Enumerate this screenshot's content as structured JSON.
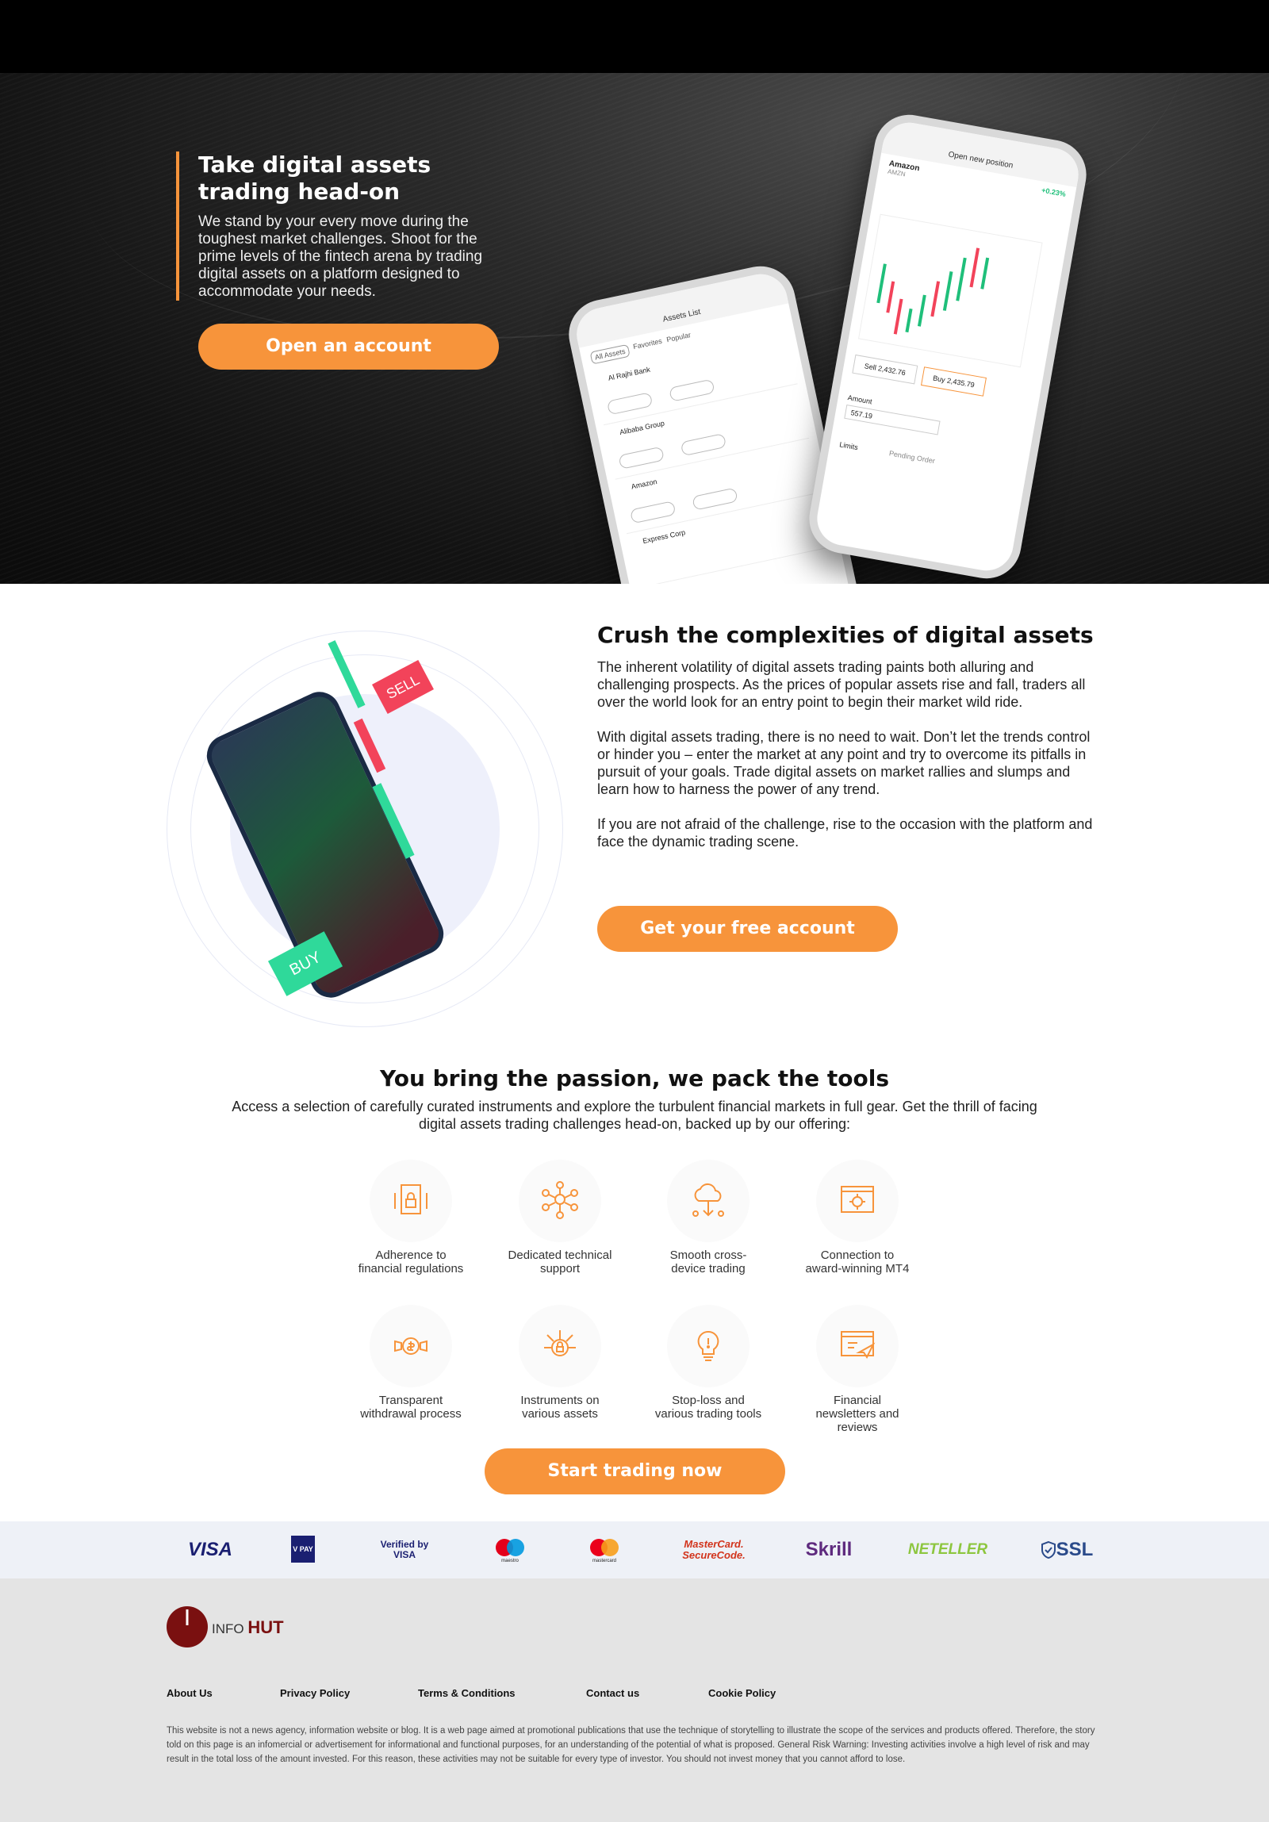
{
  "hero": {
    "title": "Take digital assets trading head-on",
    "description": "We stand by your every move during the toughest market challenges. Shoot for the prime levels of the fintech arena by trading digital assets on a platform designed to accommodate your needs.",
    "cta": "Open an account",
    "phone1": {
      "title": "Assets List",
      "tabs": [
        "All Assets",
        "Favorites",
        "Popular"
      ],
      "rows": [
        "Al Rajhi Bank",
        "Alibaba Group",
        "Amazon",
        "Express Corp"
      ]
    },
    "phone2": {
      "title": "Open new position",
      "asset": "Amazon",
      "ticker": "AMZN",
      "change": "+0.23%",
      "sell": "Sell 2,432.76",
      "buy": "Buy 2,435.79",
      "amount_label": "Amount",
      "amount": "557.19",
      "limits": "Limits",
      "pending": "Pending Order"
    }
  },
  "section2": {
    "title": "Crush the complexities of digital assets",
    "paragraphs": [
      "The inherent volatility of digital assets trading paints both alluring and challenging prospects. As the prices of popular assets rise and fall, traders all over the world look for an entry point to begin their market wild ride.",
      "With digital assets trading, there is no need to wait. Don’t let the trends control or hinder you – enter the market at any point and try to overcome its pitfalls in pursuit of your goals. Trade digital assets on market rallies and slumps and learn how to harness the power of any trend.",
      "If you are not afraid of the challenge, rise to the occasion with the platform and face the dynamic trading scene."
    ],
    "cta": "Get your free account",
    "illustration": {
      "sell": "SELL",
      "buy": "BUY"
    }
  },
  "section3": {
    "title": "You bring the passion, we pack the tools",
    "subtitle": "Access a selection of carefully curated instruments and explore the turbulent financial markets in full gear. Get the thrill of facing digital assets trading challenges head-on, backed up by our offering:",
    "features": [
      {
        "label": "Adherence to financial regulations",
        "icon": "regulation-lock-icon"
      },
      {
        "label": "Dedicated technical support",
        "icon": "support-network-icon"
      },
      {
        "label": "Smooth cross-device trading",
        "icon": "cloud-sync-icon"
      },
      {
        "label": "Connection to award-winning MT4",
        "icon": "monitor-gear-icon"
      },
      {
        "label": "Transparent withdrawal process",
        "icon": "dollar-megaphone-icon"
      },
      {
        "label": "Instruments on various assets",
        "icon": "circuit-lock-icon"
      },
      {
        "label": "Stop-loss and various trading tools",
        "icon": "lightbulb-icon"
      },
      {
        "label": "Financial newsletters and reviews",
        "icon": "paper-plane-icon"
      }
    ],
    "cta": "Start trading now"
  },
  "payments": [
    "VISA",
    "V PAY",
    "Verified by VISA",
    "maestro",
    "mastercard",
    "MasterCard. SecureCode.",
    "Skrill",
    "NETELLER",
    "SSL"
  ],
  "footer": {
    "logo_info": "INFO",
    "logo_hut": "HUT",
    "links": [
      "About Us",
      "Privacy Policy",
      "Terms & Conditions",
      "Contact us",
      "Cookie Policy"
    ],
    "disclaimer": "This website is not a news agency, information website or blog. It is a web page aimed at promotional publications that use the technique of storytelling to illustrate the scope of the services and products offered. Therefore, the story told on this page is an infomercial or advertisement for informational and functional purposes, for an understanding of the potential of what is proposed. General Risk Warning: Investing activities involve a high level of risk and may result in the total loss of the amount invested. For this reason, these activities may not be suitable for every type of investor. You should not invest money that you cannot afford to lose."
  },
  "colors": {
    "accent": "#f7943b",
    "brand": "#7a1010",
    "buy_green": "#2fd99a",
    "sell_red": "#f2435a"
  }
}
